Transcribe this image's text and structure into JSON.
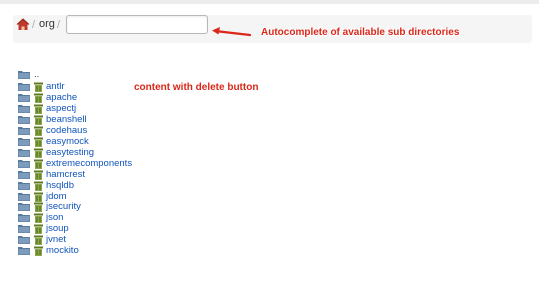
{
  "breadcrumb": {
    "home_icon": "home-icon",
    "separator": "/",
    "crumbs": [
      "org"
    ],
    "input": {
      "value": "",
      "placeholder": ""
    }
  },
  "annotations": {
    "autocomplete": "Autocomplete of available sub directories",
    "content": "content with delete button",
    "color": "#d9281a"
  },
  "listing": {
    "parent": "..",
    "entries": [
      "antlr",
      "apache",
      "aspectj",
      "beanshell",
      "codehaus",
      "easymock",
      "easytesting",
      "extremecomponents",
      "hamcrest",
      "hsqldb",
      "jdom",
      "jsecurity",
      "json",
      "jsoup",
      "jvnet",
      "mockito"
    ]
  },
  "colors": {
    "link": "#1155bb",
    "folder": "#5a7a9a",
    "trash": "#6f8f2f"
  }
}
